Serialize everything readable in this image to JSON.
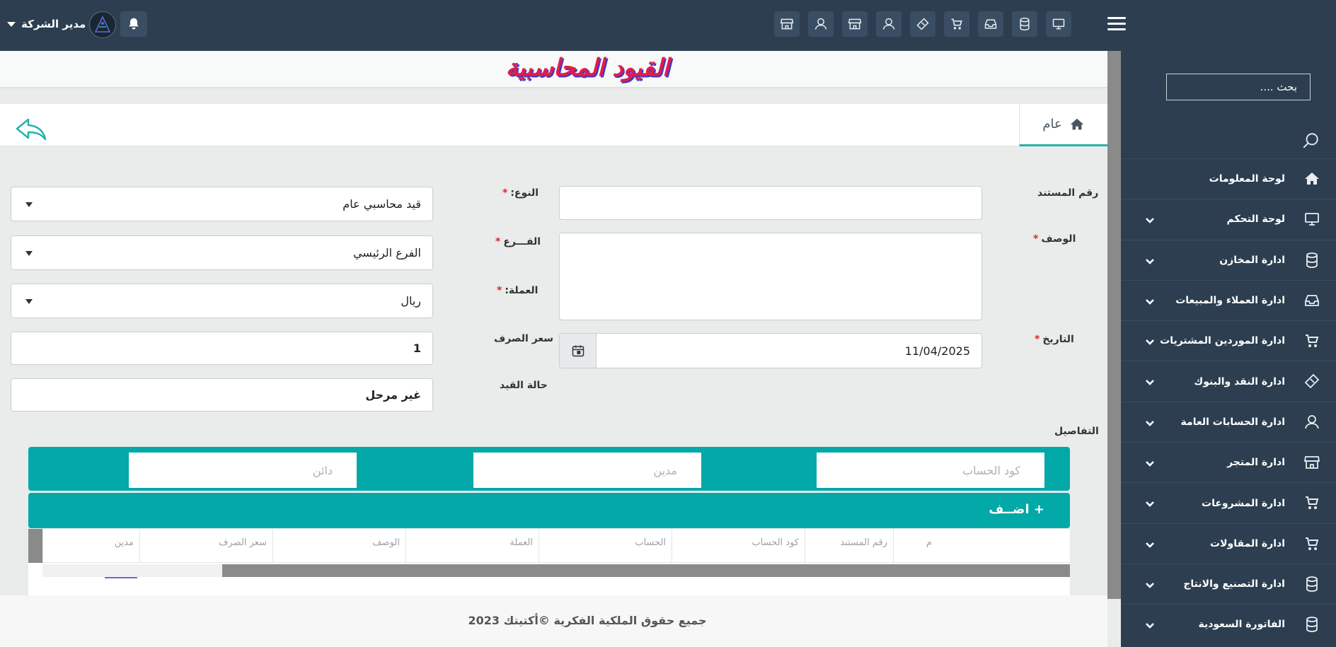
{
  "topbar": {
    "user_name": "مدير الشركة",
    "icons": [
      "store-icon",
      "user-icon",
      "store-icon",
      "user-icon",
      "ticket-icon",
      "cart-icon",
      "inbox-icon",
      "database-icon",
      "monitor-icon"
    ]
  },
  "sidebar": {
    "search_placeholder": "بحث ....",
    "items": [
      {
        "label": "لوحة المعلومات",
        "icon": "home-icon",
        "has_children": false
      },
      {
        "label": "لوحة التحكم",
        "icon": "monitor-icon",
        "has_children": true
      },
      {
        "label": "ادارة المخازن",
        "icon": "database-icon",
        "has_children": true
      },
      {
        "label": "ادارة العملاء والمبيعات",
        "icon": "inbox-icon",
        "has_children": true
      },
      {
        "label": "ادارة الموردين المشتريات",
        "icon": "cart-icon",
        "has_children": true
      },
      {
        "label": "ادارة النقد والبنوك",
        "icon": "ticket-icon",
        "has_children": true
      },
      {
        "label": "ادارة الحسابات العامة",
        "icon": "user-icon",
        "has_children": true
      },
      {
        "label": "ادارة المتجر",
        "icon": "store-icon",
        "has_children": true
      },
      {
        "label": "ادارة المشروعات",
        "icon": "cart-icon",
        "has_children": true
      },
      {
        "label": "ادارة المقاولات",
        "icon": "cart-icon",
        "has_children": true
      },
      {
        "label": "ادارة التصنيع والانتاج",
        "icon": "database-icon",
        "has_children": true
      },
      {
        "label": "الفاتورة السعودية",
        "icon": "database-icon",
        "has_children": true
      }
    ]
  },
  "page": {
    "title": "القيود المحاسبية",
    "tab_label": "عام"
  },
  "form": {
    "doc_number_label": "رقم المستند",
    "doc_number_value": "",
    "description_label": "الوصف",
    "description_value": "",
    "date_label": "التاريخ",
    "date_value": "11/04/2025",
    "type_label": "النوع:",
    "type_value": "قيد محاسبي عام",
    "branch_label": "الفـــرع",
    "branch_value": "الفرع الرئيسي",
    "currency_label": "العملة:",
    "currency_value": "ريال",
    "exchange_rate_label": "سعر الصرف",
    "exchange_rate_value": "1",
    "status_label": "حالة القيد",
    "status_value": "غير مرحل",
    "required_mark": "*"
  },
  "details": {
    "label": "التفاصيل",
    "account_code_placeholder": "كود الحساب",
    "debit_placeholder": "مدين",
    "credit_placeholder": "دائن",
    "add_label": "اضــف",
    "add_plus": "+",
    "columns": [
      "م",
      "رقم المستند",
      "كود الحساب",
      "الحساب",
      "العملة",
      "الوصف",
      "سعر الصرف",
      "مدين"
    ]
  },
  "footer": {
    "text": "جميع حقوق الملكية الفكرية ©أكتيتك 2023"
  }
}
